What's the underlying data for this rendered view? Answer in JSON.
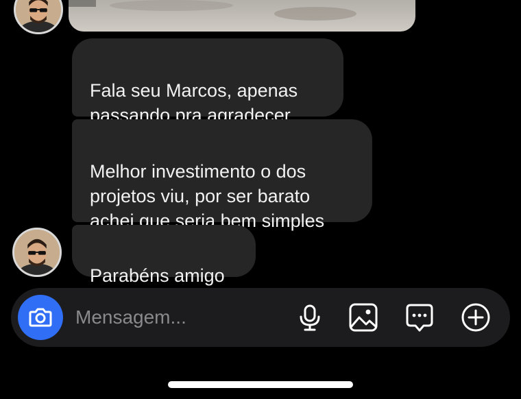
{
  "conversation": {
    "messages": [
      {
        "text": "Fala seu Marcos, apenas\npassando pra agradecer"
      },
      {
        "text": "Melhor investimento o dos\nprojetos viu, por ser barato\nachei que seria bem simples"
      },
      {
        "text": "Parabéns amigo"
      }
    ]
  },
  "composer": {
    "placeholder": "Mensagem..."
  },
  "colors": {
    "bubble": "#262626",
    "camera": "#2f6ef5",
    "background": "#000000"
  },
  "icons": [
    "camera-icon",
    "microphone-icon",
    "gallery-icon",
    "sticker-icon",
    "plus-icon"
  ]
}
